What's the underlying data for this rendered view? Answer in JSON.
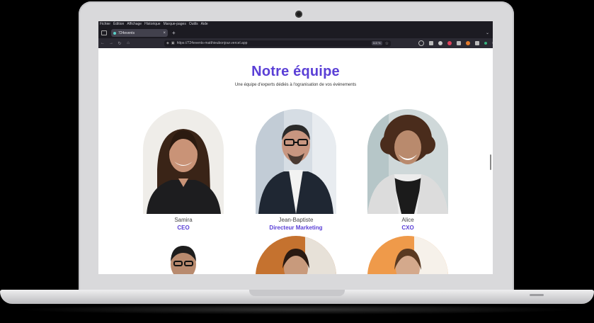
{
  "browser": {
    "menu": [
      "Fichier",
      "Édition",
      "Affichage",
      "Historique",
      "Marque-pages",
      "Outils",
      "Aide"
    ],
    "tab_title": "724events",
    "tab_close": "×",
    "new_tab": "+",
    "url": "https://724events-matthieubonjour.vercel.app",
    "zoom": "110 %"
  },
  "page": {
    "title": "Notre équipe",
    "subtitle": "Une équipe d'experts dédiés à l'ogranisation de vos événements"
  },
  "team": [
    {
      "name": "Samira",
      "role": "CEO"
    },
    {
      "name": "Jean-Baptiste",
      "role": "Directeur Marketing"
    },
    {
      "name": "Alice",
      "role": "CXO"
    }
  ],
  "colors": {
    "accent": "#5a3fd6",
    "browser_dark": "#1c1b22"
  }
}
